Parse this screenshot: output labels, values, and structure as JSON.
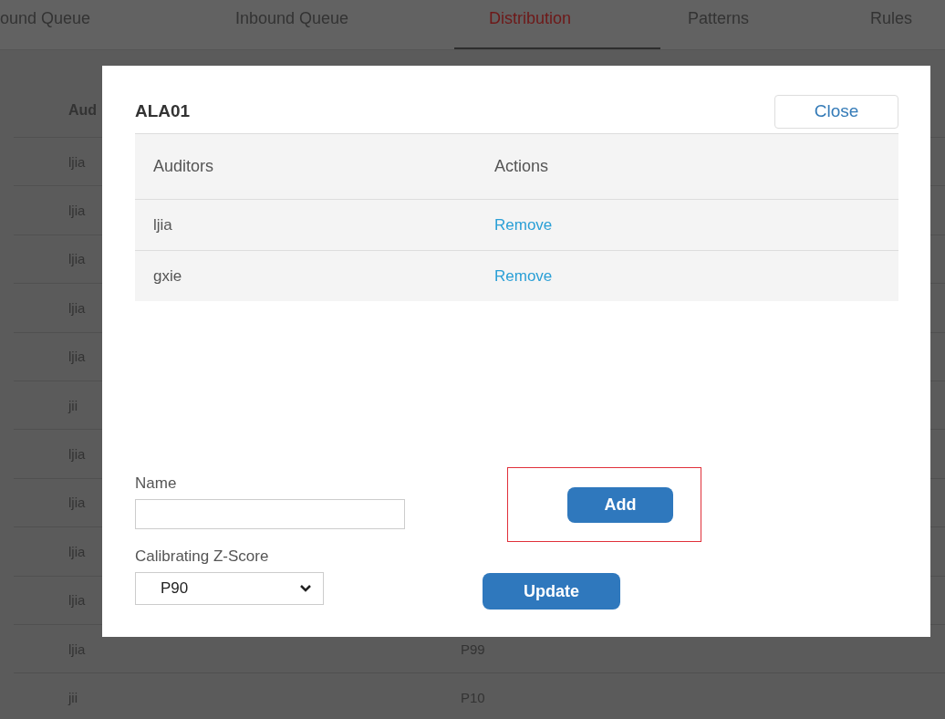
{
  "tabs": [
    {
      "label": "ound Queue",
      "selected": false
    },
    {
      "label": "Inbound Queue",
      "selected": false
    },
    {
      "label": "Distribution",
      "selected": true
    },
    {
      "label": "Patterns",
      "selected": false
    },
    {
      "label": "Rules",
      "selected": false
    }
  ],
  "table": {
    "header": "Aud",
    "rows": [
      {
        "auditor": "ljia"
      },
      {
        "auditor": "ljia"
      },
      {
        "auditor": "ljia"
      },
      {
        "auditor": "ljia"
      },
      {
        "auditor": "ljia"
      },
      {
        "auditor": "jii"
      },
      {
        "auditor": "ljia"
      },
      {
        "auditor": "ljia"
      },
      {
        "auditor": "ljia"
      },
      {
        "auditor": "ljia"
      },
      {
        "auditor": "ljia",
        "zscore": "P99"
      },
      {
        "auditor": "jii",
        "zscore": "P10"
      }
    ]
  },
  "dialog": {
    "title": "ALA01",
    "close": "Close",
    "columns": [
      "Auditors",
      "Actions"
    ],
    "rows": [
      {
        "auditor": "ljia",
        "action": "Remove"
      },
      {
        "auditor": "gxie",
        "action": "Remove"
      }
    ],
    "name_label": "Name",
    "add": "Add",
    "zscore_label": "Calibrating Z-Score",
    "zscore_value": "P90",
    "update": "Update"
  }
}
